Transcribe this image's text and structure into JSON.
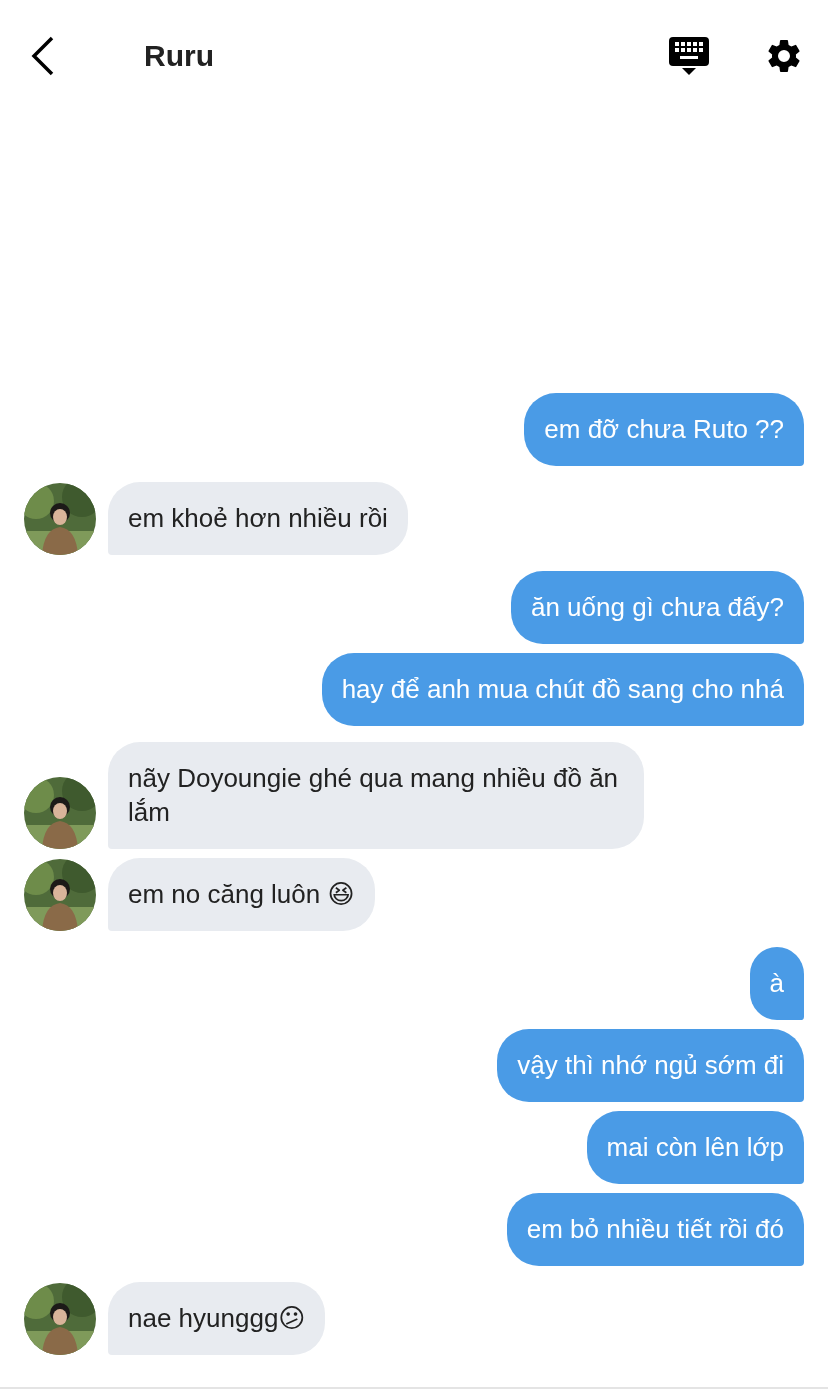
{
  "header": {
    "title": "Ruru"
  },
  "messages": [
    {
      "kind": "outgoing",
      "text": "em đỡ chưa Ruto ??"
    },
    {
      "kind": "incoming",
      "text": "em khoẻ hơn nhiều rồi"
    },
    {
      "kind": "outgoing",
      "text": "ăn uống gì chưa đấy?"
    },
    {
      "kind": "outgoing",
      "text": "hay để anh mua chút đồ sang cho nhá"
    },
    {
      "kind": "incoming",
      "text": "nãy Doyoungie ghé qua mang nhiều đồ ăn lắm"
    },
    {
      "kind": "incoming",
      "text": "em no căng luôn 😆"
    },
    {
      "kind": "outgoing",
      "text": "à"
    },
    {
      "kind": "outgoing",
      "text": "vậy thì nhớ ngủ sớm đi"
    },
    {
      "kind": "outgoing",
      "text": "mai còn lên lớp"
    },
    {
      "kind": "outgoing",
      "text": "em bỏ nhiều tiết rồi đó"
    },
    {
      "kind": "incoming",
      "text": "nae hyunggg😕"
    }
  ]
}
